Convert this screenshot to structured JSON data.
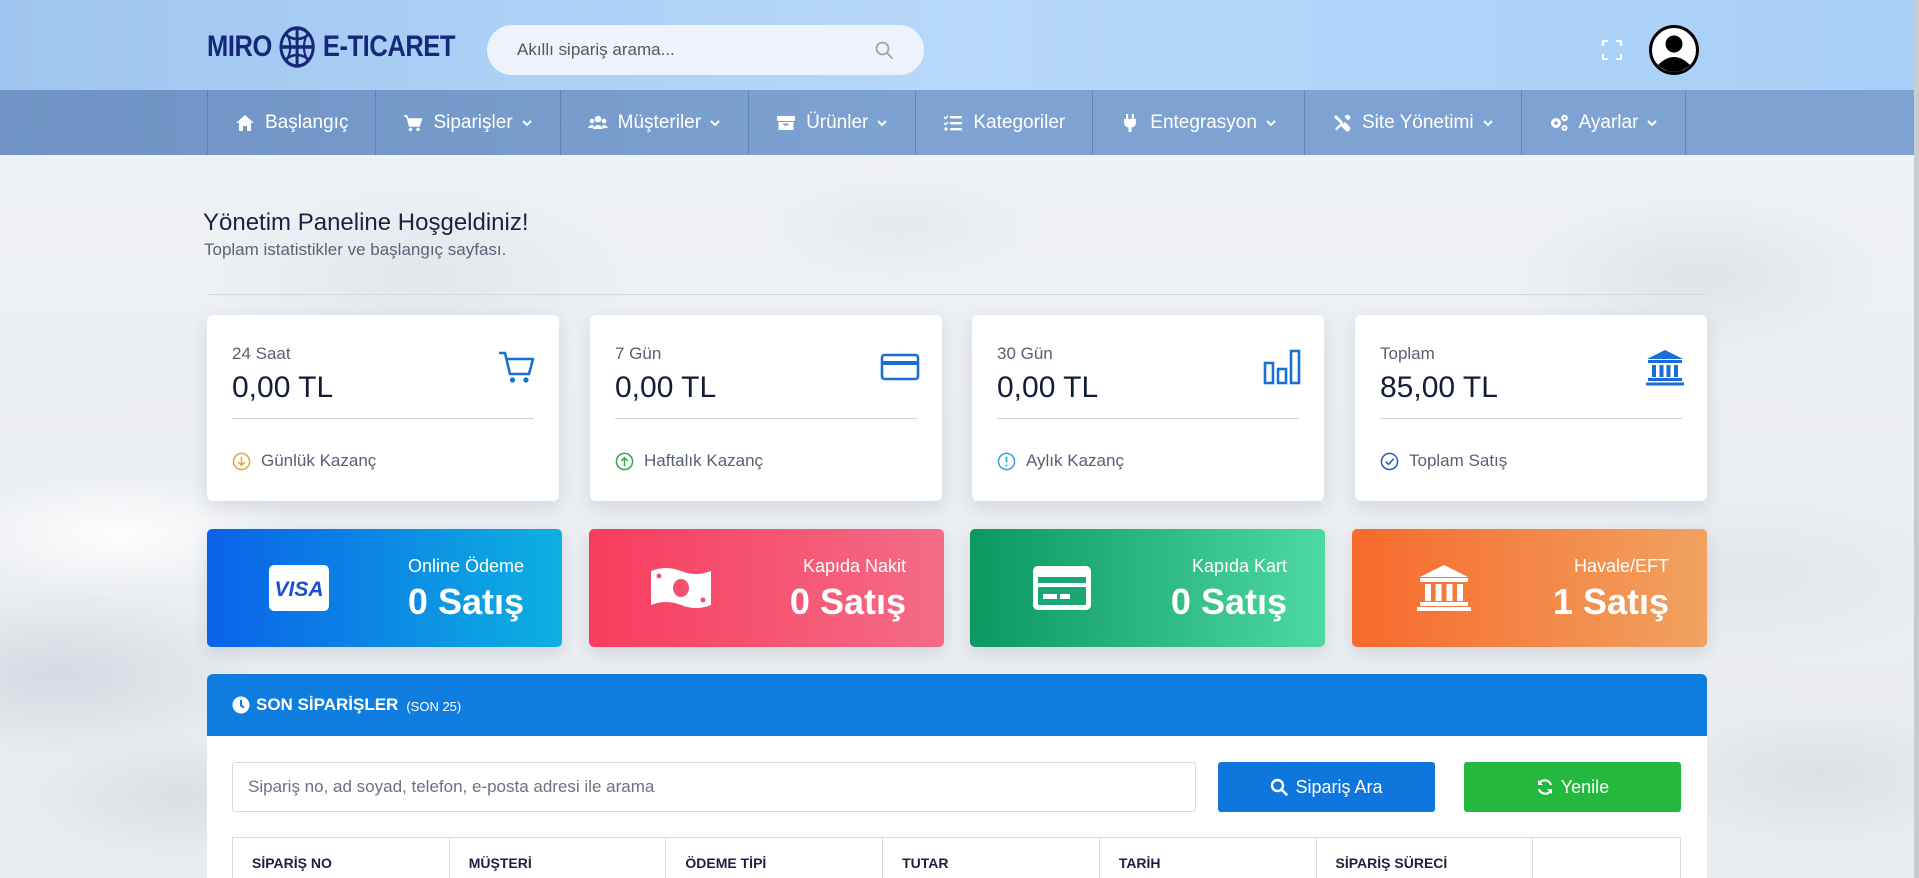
{
  "colors": {
    "primary": "#0f7de0",
    "success": "#24b83f",
    "brand": "#16287a"
  },
  "header": {
    "logo_left": "MIRO",
    "logo_right": "E-TICARET",
    "search_placeholder": "Akıllı sipariş arama..."
  },
  "nav": {
    "items": [
      {
        "label": "Başlangıç",
        "icon": "home-icon",
        "dropdown": false
      },
      {
        "label": "Siparişler",
        "icon": "cart-icon",
        "dropdown": true
      },
      {
        "label": "Müşteriler",
        "icon": "users-icon",
        "dropdown": true
      },
      {
        "label": "Ürünler",
        "icon": "box-icon",
        "dropdown": true
      },
      {
        "label": "Kategoriler",
        "icon": "list-icon",
        "dropdown": false
      },
      {
        "label": "Entegrasyon",
        "icon": "plug-icon",
        "dropdown": true
      },
      {
        "label": "Site Yönetimi",
        "icon": "tools-icon",
        "dropdown": true
      },
      {
        "label": "Ayarlar",
        "icon": "gears-icon",
        "dropdown": true
      }
    ]
  },
  "welcome": {
    "title": "Yönetim Paneline Hoşgeldiniz!",
    "subtitle": "Toplam istatistikler ve başlangıç sayfası."
  },
  "stats": [
    {
      "label": "24 Saat",
      "value": "0,00 TL",
      "footer": "Günlük Kazanç",
      "icon": "cart-outline-icon",
      "footer_icon": "arrow-down-circle-icon",
      "footer_color": "#e0a93a"
    },
    {
      "label": "7 Gün",
      "value": "0,00 TL",
      "footer": "Haftalık Kazanç",
      "icon": "credit-card-icon",
      "footer_icon": "arrow-up-circle-icon",
      "footer_color": "#2fa84f"
    },
    {
      "label": "30 Gün",
      "value": "0,00 TL",
      "footer": "Aylık Kazanç",
      "icon": "bar-chart-icon",
      "footer_icon": "info-circle-icon",
      "footer_color": "#2aa7e0"
    },
    {
      "label": "Toplam",
      "value": "85,00 TL",
      "footer": "Toplam Satış",
      "icon": "bank-icon",
      "footer_icon": "check-circle-icon",
      "footer_color": "#2a5db0"
    }
  ],
  "payments": [
    {
      "label": "Online Ödeme",
      "value": "0 Satış",
      "icon": "visa-icon",
      "icon_text": "VISA",
      "gradient": [
        "#0a62e8",
        "#0db0e0"
      ]
    },
    {
      "label": "Kapıda Nakit",
      "value": "0 Satış",
      "icon": "cash-icon",
      "gradient": [
        "#f83c5e",
        "#f46c86"
      ]
    },
    {
      "label": "Kapıda Kart",
      "value": "0 Satış",
      "icon": "card-icon",
      "gradient": [
        "#0b9760",
        "#4ed8a4"
      ]
    },
    {
      "label": "Havale/EFT",
      "value": "1 Satış",
      "icon": "bank-icon",
      "gradient": [
        "#f76a2c",
        "#f0a260"
      ]
    }
  ],
  "orders": {
    "title": "SON SİPARİŞLER",
    "subtitle": "(SON 25)",
    "search_placeholder": "Sipariş no, ad soyad, telefon, e-posta adresi ile arama",
    "search_button": "Sipariş Ara",
    "refresh_button": "Yenile",
    "columns": [
      "SİPARİŞ NO",
      "MÜŞTERİ",
      "ÖDEME TİPİ",
      "TUTAR",
      "TARİH",
      "SİPARİŞ SÜRECİ",
      ""
    ]
  }
}
